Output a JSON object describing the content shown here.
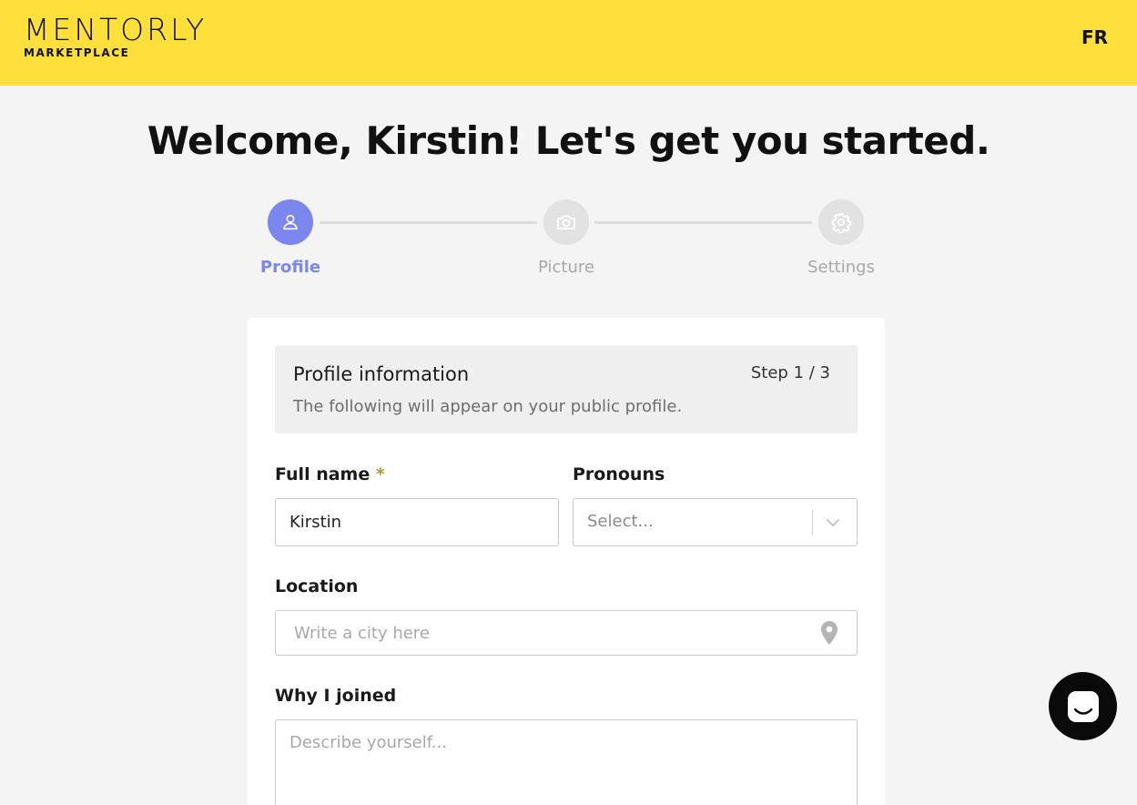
{
  "header": {
    "logo_main": "MENTORLY",
    "logo_sub": "MARKETPLACE",
    "language_toggle": "FR",
    "background_color": "#ffe03a"
  },
  "welcome_title": "Welcome, Kirstin! Let's get you started.",
  "stepper": {
    "accent_color": "#7b86ee",
    "steps": [
      {
        "label": "Profile",
        "icon": "user-icon",
        "state": "active"
      },
      {
        "label": "Picture",
        "icon": "camera-icon",
        "state": "inactive"
      },
      {
        "label": "Settings",
        "icon": "gear-icon",
        "state": "inactive"
      }
    ]
  },
  "form": {
    "section_title": "Profile information",
    "step_indicator": "Step 1 / 3",
    "section_description": "The following will appear on your public profile.",
    "full_name": {
      "label": "Full name",
      "required_mark": "*",
      "value": "Kirstin"
    },
    "pronouns": {
      "label": "Pronouns",
      "placeholder": "Select..."
    },
    "location": {
      "label": "Location",
      "placeholder": "Write a city here",
      "icon": "map-pin-icon"
    },
    "why_joined": {
      "label": "Why I joined",
      "placeholder": "Describe yourself..."
    }
  },
  "chat_widget": {
    "icon": "chat-icon"
  }
}
